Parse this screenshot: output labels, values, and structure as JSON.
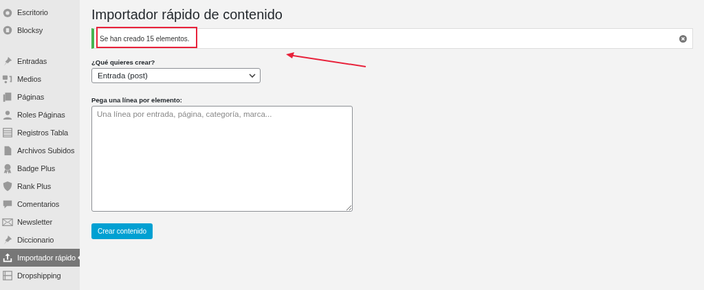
{
  "sidebar": {
    "groups": [
      {
        "items": [
          {
            "label": "Escritorio",
            "selected": false
          },
          {
            "label": "Blocksy",
            "selected": false
          }
        ]
      },
      {
        "items": [
          {
            "label": "Entradas",
            "selected": false
          },
          {
            "label": "Medios",
            "selected": false
          },
          {
            "label": "Páginas",
            "selected": false
          },
          {
            "label": "Roles Páginas",
            "selected": false
          },
          {
            "label": "Registros Tabla",
            "selected": false
          },
          {
            "label": "Archivos Subidos",
            "selected": false
          },
          {
            "label": "Badge Plus",
            "selected": false
          },
          {
            "label": "Rank Plus",
            "selected": false
          },
          {
            "label": "Comentarios",
            "selected": false
          },
          {
            "label": "Newsletter",
            "selected": false
          },
          {
            "label": "Diccionario",
            "selected": false
          },
          {
            "label": "Importador rápido",
            "selected": true
          },
          {
            "label": "Dropshipping",
            "selected": false
          }
        ]
      }
    ]
  },
  "page": {
    "title": "Importador rápido de contenido",
    "notice": {
      "message": "Se han creado 15 elementos."
    },
    "type_field": {
      "label": "¿Qué quieres crear?",
      "value": "Entrada (post)"
    },
    "lines_field": {
      "label": "Pega una línea por elemento:",
      "placeholder": "Una línea por entrada, página, categoría, marca..."
    },
    "submit": "Crear contenido"
  }
}
